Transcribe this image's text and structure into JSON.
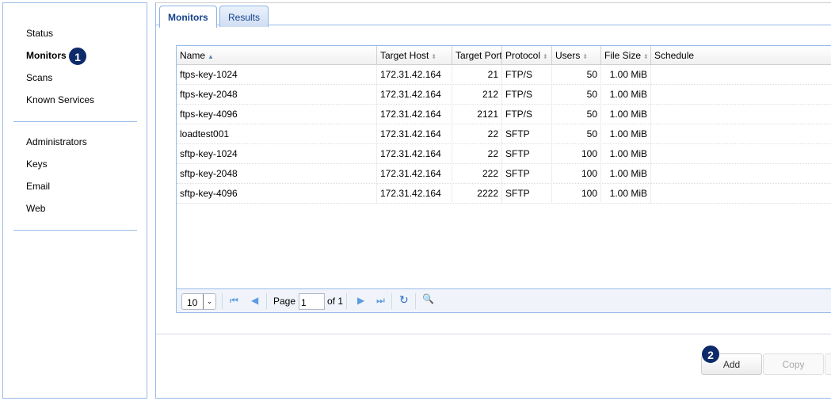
{
  "sidebar": {
    "group1": [
      "Status",
      "Monitors",
      "Scans",
      "Known Services"
    ],
    "group2": [
      "Administrators",
      "Keys",
      "Email",
      "Web"
    ],
    "active": "Monitors"
  },
  "callouts": [
    "1",
    "2"
  ],
  "tabs": [
    "Monitors",
    "Results"
  ],
  "grid": {
    "columns": [
      "Name",
      "Target Host",
      "Target Port",
      "Protocol",
      "Users",
      "File Size",
      "Schedule"
    ],
    "sorted_column": "Name",
    "sort_direction": "ascending",
    "rows": [
      [
        "ftps-key-1024",
        "172.31.42.164",
        "21",
        "FTP/S",
        "50",
        "1.00 MiB",
        ""
      ],
      [
        "ftps-key-2048",
        "172.31.42.164",
        "212",
        "FTP/S",
        "50",
        "1.00 MiB",
        ""
      ],
      [
        "ftps-key-4096",
        "172.31.42.164",
        "2121",
        "FTP/S",
        "50",
        "1.00 MiB",
        ""
      ],
      [
        "loadtest001",
        "172.31.42.164",
        "22",
        "SFTP",
        "50",
        "1.00 MiB",
        ""
      ],
      [
        "sftp-key-1024",
        "172.31.42.164",
        "22",
        "SFTP",
        "100",
        "1.00 MiB",
        ""
      ],
      [
        "sftp-key-2048",
        "172.31.42.164",
        "222",
        "SFTP",
        "100",
        "1.00 MiB",
        ""
      ],
      [
        "sftp-key-4096",
        "172.31.42.164",
        "2222",
        "SFTP",
        "100",
        "1.00 MiB",
        ""
      ]
    ]
  },
  "pager": {
    "page_size": "10",
    "page_label": "Page",
    "page": "1",
    "of_label": "of 1"
  },
  "buttons": {
    "add": "Add",
    "copy": "Copy"
  }
}
